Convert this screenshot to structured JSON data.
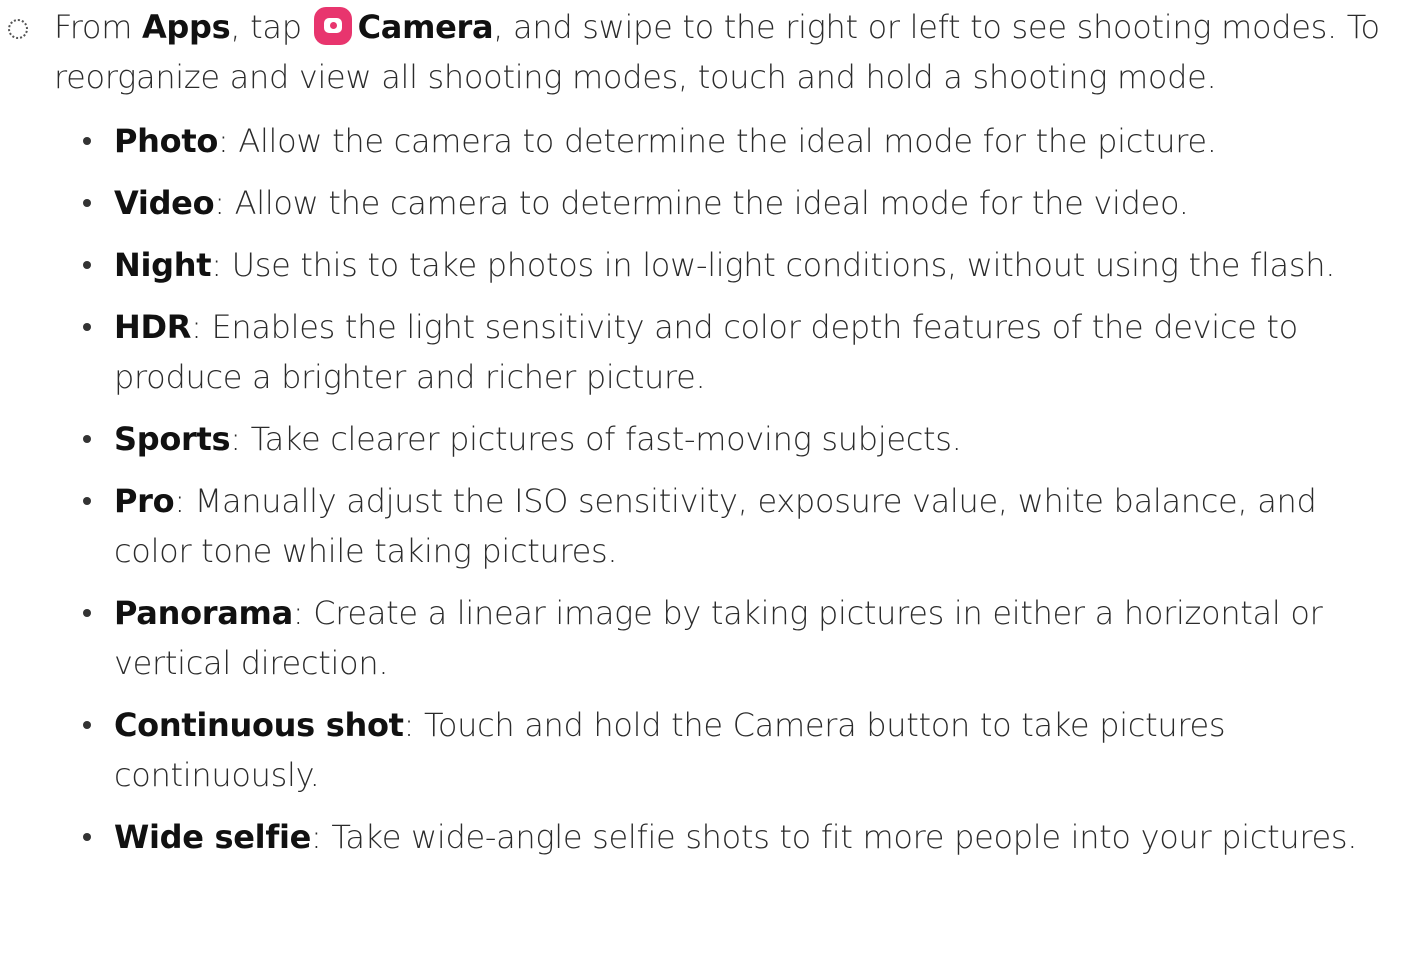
{
  "step": {
    "pre": "From ",
    "apps": "Apps",
    "mid": ", tap ",
    "camera": "Camera",
    "post": ", and swipe to the right or left to see shooting modes. To reorganize and view all shooting modes, touch and hold a shooting mode."
  },
  "modes": [
    {
      "name": "Photo",
      "desc": ": Allow the camera to determine the ideal mode for the picture."
    },
    {
      "name": "Video",
      "desc": ": Allow the camera to determine the ideal mode for the video."
    },
    {
      "name": "Night",
      "desc": ": Use this to take photos in low-light conditions, without using the flash."
    },
    {
      "name": "HDR",
      "desc": ": Enables the light sensitivity and color depth features of the device to produce a brighter and richer picture."
    },
    {
      "name": "Sports",
      "desc": ": Take clearer pictures of fast-moving subjects."
    },
    {
      "name": "Pro",
      "desc": ": Manually adjust the ISO sensitivity, exposure value, white balance, and color tone while taking pictures."
    },
    {
      "name": "Panorama",
      "desc": ": Create a linear image by taking pictures in either a horizontal or vertical direction."
    },
    {
      "name": "Continuous shot",
      "desc": ": Touch and hold the Camera button to take pictures continuously."
    },
    {
      "name": "Wide selfie",
      "desc": ": Take wide-angle selfie shots to fit more people into your pictures."
    }
  ],
  "icons": {
    "step_marker": "step-circle-icon",
    "camera": "camera-app-icon",
    "bullet": "bullet-dot-icon"
  },
  "colors": {
    "camera_icon_bg": "#e8356e",
    "text": "#2b2b2b",
    "bold_text": "#111111"
  }
}
